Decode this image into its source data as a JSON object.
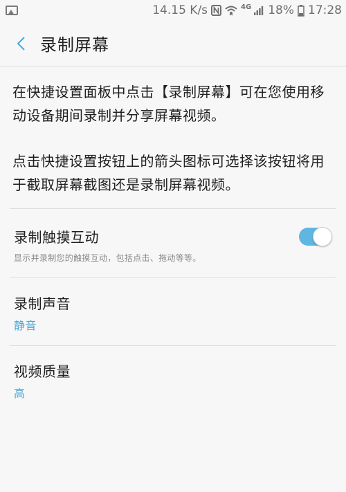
{
  "status_bar": {
    "net_speed": "14.15 K/s",
    "network_type": "4G",
    "battery": "18%",
    "time": "17:28",
    "icons": [
      "image-icon",
      "nfc-icon",
      "wifi-icon",
      "signal-icon",
      "battery-icon"
    ]
  },
  "header": {
    "back_icon": "chevron-left-icon",
    "title": "录制屏幕"
  },
  "description": {
    "paragraph1": "在快捷设置面板中点击【录制屏幕】可在您使用移动设备期间录制并分享屏幕视频。",
    "paragraph2": "点击快捷设置按钮上的箭头图标可选择该按钮将用于截取屏幕截图还是录制屏幕视频。"
  },
  "settings": {
    "record_touch": {
      "title": "录制触摸互动",
      "subtitle": "显示并录制您的触摸互动，包括点击、拖动等等。",
      "enabled": true
    },
    "record_sound": {
      "title": "录制声音",
      "value": "静音"
    },
    "video_quality": {
      "title": "视频质量",
      "value": "高"
    }
  },
  "colors": {
    "accent": "#4aa8d8",
    "toggle_on": "#5fb6e0",
    "background": "#f7f7f7"
  }
}
